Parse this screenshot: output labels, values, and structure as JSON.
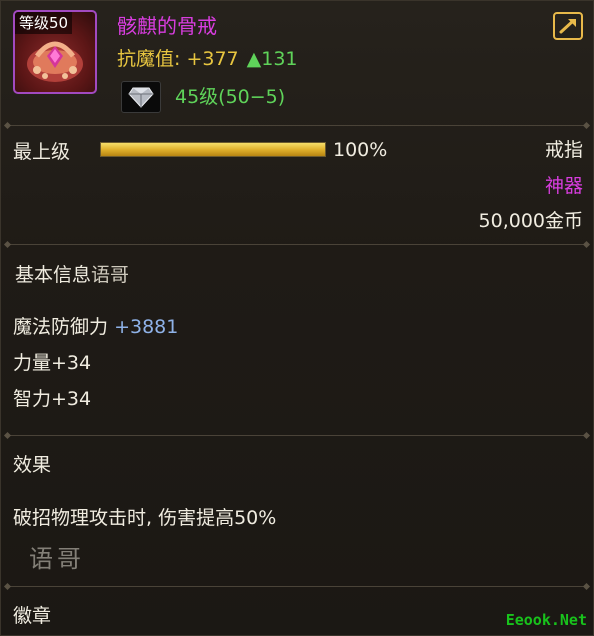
{
  "item": {
    "level_badge": "等级50",
    "name": "骸麒的骨戒",
    "resist_label": "抗魔值: +377",
    "resist_up": "▲131",
    "gem_level": "45级(50−5)"
  },
  "upgrade": {
    "label": "最上级",
    "percent_text": "100%",
    "progress_fraction": 1.0
  },
  "meta": {
    "type": "戒指",
    "rarity": "神器",
    "price": "50,000金币"
  },
  "basic_info": {
    "title": "基本信息",
    "watermark": "语哥",
    "stats": [
      {
        "label": "魔法防御力",
        "value": "+3881"
      },
      {
        "label": "力量+34"
      },
      {
        "label": "智力+34"
      }
    ]
  },
  "effect": {
    "title": "效果",
    "text": "破招物理攻击时, 伤害提高50%",
    "handwriting": "语哥"
  },
  "badge": {
    "title": "徽章"
  },
  "site_watermark": "Eeook.Net",
  "colors": {
    "rarity": "#d93de0",
    "resist": "#e8c640",
    "positive": "#5fd35a",
    "stat_blue": "#8fb2e8",
    "bar": "#e0b12c"
  },
  "icons": {
    "item": "bone-ring-icon",
    "gem": "diamond-gem-icon",
    "share": "share-export-icon"
  }
}
